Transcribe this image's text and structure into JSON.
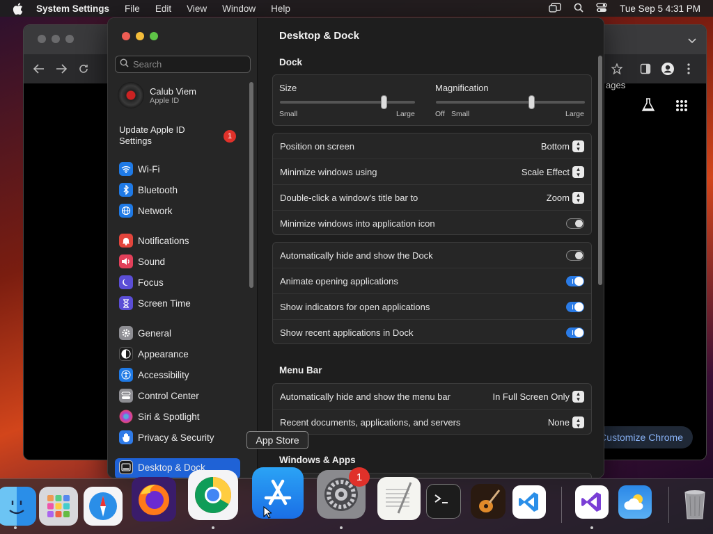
{
  "menubar": {
    "app_name": "System Settings",
    "items": [
      "File",
      "Edit",
      "View",
      "Window",
      "Help"
    ],
    "clock": "Tue Sep 5  4:31 PM"
  },
  "chrome": {
    "link_partial": "ages",
    "customize_label": "Customize Chrome"
  },
  "sidebar": {
    "search_placeholder": "Search",
    "account_name": "Calub Viem",
    "account_sub": "Apple ID",
    "update_label": "Update Apple ID Settings",
    "update_badge": "1",
    "items": [
      {
        "label": "Wi-Fi",
        "icon": "wifi-icon",
        "color": "#1f7ae6"
      },
      {
        "label": "Bluetooth",
        "icon": "bluetooth-icon",
        "color": "#1f7ae6"
      },
      {
        "label": "Network",
        "icon": "globe-icon",
        "color": "#1f7ae6"
      },
      {
        "label": "Notifications",
        "icon": "bell-icon",
        "color": "#e2453c"
      },
      {
        "label": "Sound",
        "icon": "speaker-icon",
        "color": "#e2405a"
      },
      {
        "label": "Focus",
        "icon": "moon-icon",
        "color": "#5b4ed6"
      },
      {
        "label": "Screen Time",
        "icon": "hourglass-icon",
        "color": "#5b4ed6"
      },
      {
        "label": "General",
        "icon": "gear-icon",
        "color": "#8e8e93"
      },
      {
        "label": "Appearance",
        "icon": "appearance-icon",
        "color": "#1c1c1c"
      },
      {
        "label": "Accessibility",
        "icon": "accessibility-icon",
        "color": "#1f7ae6"
      },
      {
        "label": "Control Center",
        "icon": "control-center-icon",
        "color": "#8e8e93"
      },
      {
        "label": "Siri & Spotlight",
        "icon": "siri-icon",
        "color": "#b040d0"
      },
      {
        "label": "Privacy & Security",
        "icon": "hand-icon",
        "color": "#2f7be8"
      },
      {
        "label": "Desktop & Dock",
        "icon": "dock-icon",
        "color": "#1c1c1c"
      }
    ]
  },
  "content": {
    "title": "Desktop & Dock",
    "dock_section": "Dock",
    "size_label": "Size",
    "size_min": "Small",
    "size_max": "Large",
    "size_value": 0.77,
    "mag_label": "Magnification",
    "mag_off": "Off",
    "mag_min": "Small",
    "mag_max": "Large",
    "mag_value": 0.64,
    "rows_group1": [
      {
        "label": "Position on screen",
        "value": "Bottom",
        "type": "popup"
      },
      {
        "label": "Minimize windows using",
        "value": "Scale Effect",
        "type": "popup"
      },
      {
        "label": "Double-click a window's title bar to",
        "value": "Zoom",
        "type": "popup"
      },
      {
        "label": "Minimize windows into application icon",
        "value": "off",
        "type": "toggle"
      }
    ],
    "rows_group2": [
      {
        "label": "Automatically hide and show the Dock",
        "value": "off",
        "type": "toggle"
      },
      {
        "label": "Animate opening applications",
        "value": "on",
        "type": "toggle"
      },
      {
        "label": "Show indicators for open applications",
        "value": "on",
        "type": "toggle"
      },
      {
        "label": "Show recent applications in Dock",
        "value": "on",
        "type": "toggle"
      }
    ],
    "menubar_section": "Menu Bar",
    "rows_group3": [
      {
        "label": "Automatically hide and show the menu bar",
        "value": "In Full Screen Only",
        "type": "popup"
      },
      {
        "label": "Recent documents, applications, and servers",
        "value": "None",
        "type": "popup"
      }
    ],
    "windows_section": "Windows & Apps"
  },
  "tooltip": "App Store",
  "dock": {
    "apps": [
      "Finder",
      "Launchpad",
      "Safari",
      "Firefox",
      "Chrome",
      "App Store",
      "System Settings",
      "TextEdit",
      "Terminal",
      "GarageBand",
      "Visual Studio Code",
      "Visual Studio",
      "Weather",
      "Trash"
    ],
    "settings_badge": "1"
  }
}
